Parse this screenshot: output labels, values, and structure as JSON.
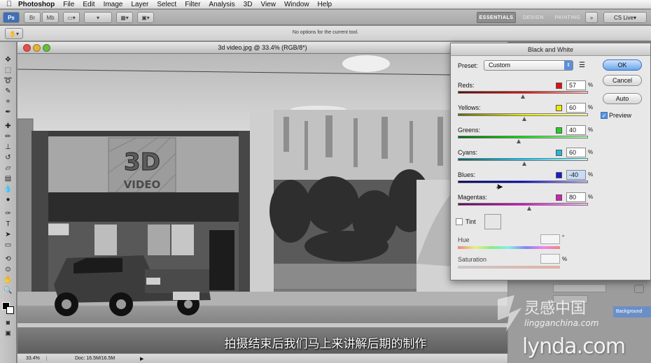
{
  "menubar": {
    "apple": "",
    "app_name": "Photoshop",
    "items": [
      "File",
      "Edit",
      "Image",
      "Layer",
      "Select",
      "Filter",
      "Analysis",
      "3D",
      "View",
      "Window",
      "Help"
    ]
  },
  "appbar": {
    "workspaces": [
      "ESSENTIALS",
      "DESIGN",
      "PAINTING"
    ],
    "cslive": "CS Live"
  },
  "optionsbar": {
    "note": "No options for the current tool."
  },
  "document": {
    "title": "3d video.jpg @ 33.4% (RGB/8*)",
    "sign_3d": "3D",
    "sign_video": "VIDEO",
    "zoom": "33.4%",
    "doc_info": "Doc: 16.5M/16.5M"
  },
  "dialog": {
    "title": "Black and White",
    "preset_label": "Preset:",
    "preset_value": "Custom",
    "ok": "OK",
    "cancel": "Cancel",
    "auto": "Auto",
    "preview": "Preview",
    "tint": "Tint",
    "hue": "Hue",
    "saturation": "Saturation",
    "hue_unit": "°",
    "sat_unit": "%",
    "sliders": [
      {
        "name": "Reds:",
        "value": "57",
        "unit": "%",
        "color": "#e01010",
        "pos": 0.5
      },
      {
        "name": "Yellows:",
        "value": "60",
        "unit": "%",
        "color": "#f0e800",
        "pos": 0.51
      },
      {
        "name": "Greens:",
        "value": "40",
        "unit": "%",
        "color": "#22d022",
        "pos": 0.47
      },
      {
        "name": "Cyans:",
        "value": "60",
        "unit": "%",
        "color": "#22b8d8",
        "pos": 0.51
      },
      {
        "name": "Blues:",
        "value": "-40",
        "unit": "%",
        "color": "#1a1ad0",
        "pos": 0.31
      },
      {
        "name": "Magentas:",
        "value": "80",
        "unit": "%",
        "color": "#d020b0",
        "pos": 0.55
      }
    ]
  },
  "subtitle": "拍摄结束后我们马上来讲解后期的制作",
  "watermarks": {
    "lingan_cn": "灵感中国",
    "lingan_url": "lingganchina.com",
    "lynda": "lynda.com"
  },
  "panels": {
    "layer_name": "Background"
  }
}
